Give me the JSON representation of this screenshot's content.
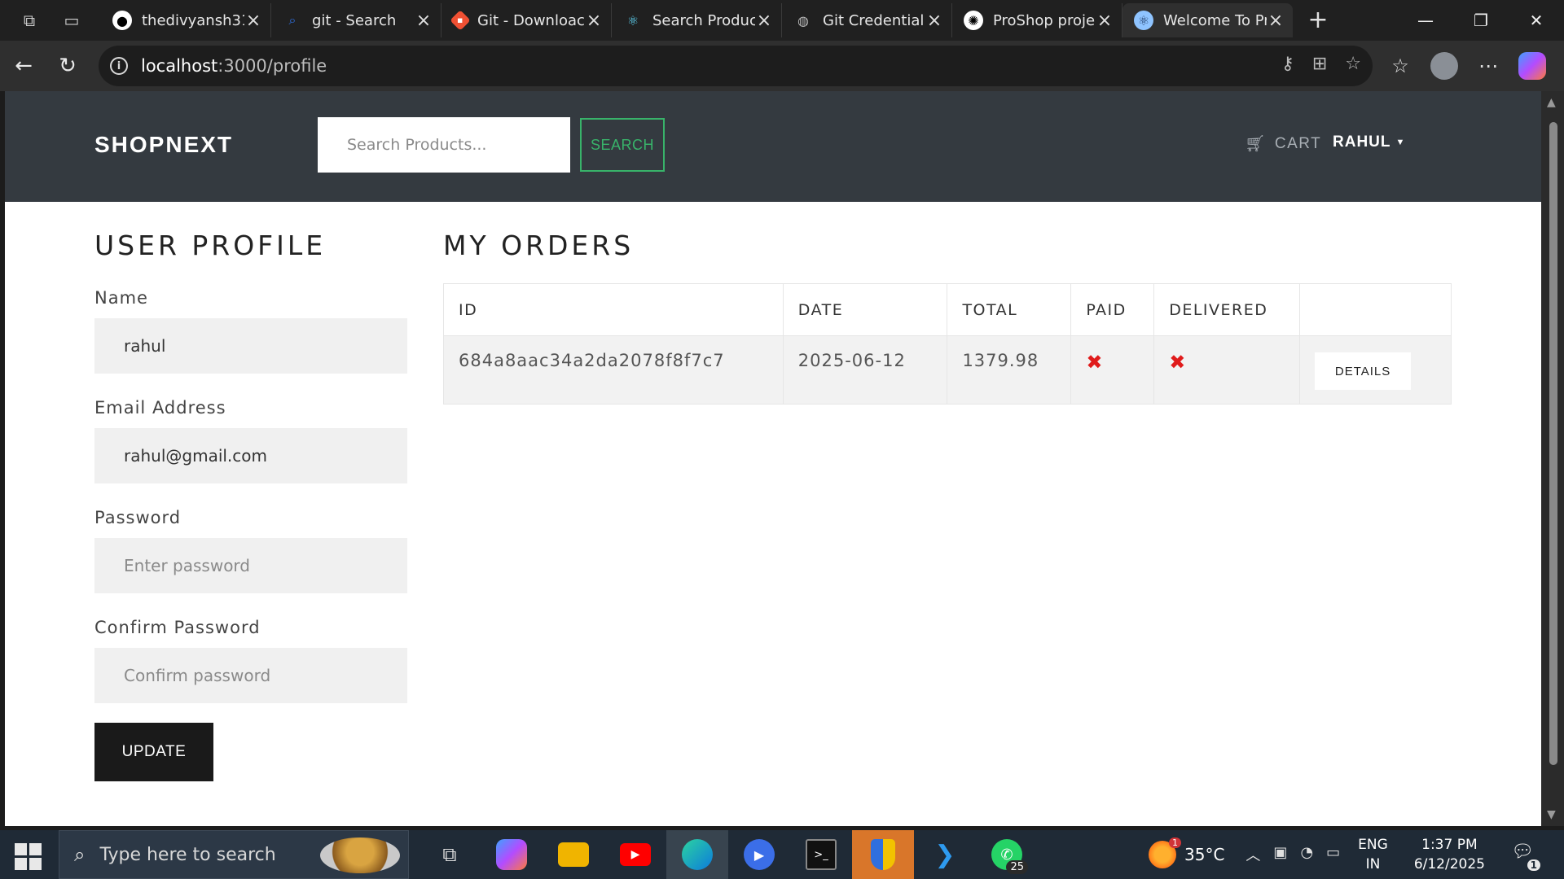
{
  "browser": {
    "tabs": [
      {
        "title": "thedivyansh31",
        "icon": "github-icon",
        "color": "#ffffff"
      },
      {
        "title": "git - Search",
        "icon": "search-icon",
        "color": "#2f6fde"
      },
      {
        "title": "Git - Downloac",
        "icon": "git-icon",
        "color": "#f05033"
      },
      {
        "title": "Search Produc",
        "icon": "react-icon",
        "color": "#61dafb"
      },
      {
        "title": "Git Credential",
        "icon": "globe-icon",
        "color": "#bbbbbb"
      },
      {
        "title": "ProShop proje",
        "icon": "chatgpt-icon",
        "color": "#ffffff"
      },
      {
        "title": "Welcome To Pr",
        "icon": "react-icon",
        "color": "#8fc4ff",
        "active": true
      }
    ],
    "url": {
      "host": "localhost",
      "path": ":3000/profile"
    }
  },
  "header": {
    "brand": "SHOPNEXT",
    "search_placeholder": "Search Products...",
    "search_button": "SEARCH",
    "cart_label": "CART",
    "user_label": "RAHUL"
  },
  "profile": {
    "title": "USER PROFILE",
    "name_label": "Name",
    "name_value": "rahul",
    "email_label": "Email Address",
    "email_value": "rahul@gmail.com",
    "password_label": "Password",
    "password_placeholder": "Enter password",
    "confirm_label": "Confirm Password",
    "confirm_placeholder": "Confirm password",
    "update_button": "UPDATE"
  },
  "orders": {
    "title": "MY ORDERS",
    "columns": [
      "ID",
      "DATE",
      "TOTAL",
      "PAID",
      "DELIVERED",
      ""
    ],
    "rows": [
      {
        "id": "684a8aac34a2da2078f8f7c7",
        "date": "2025-06-12",
        "total": "1379.98",
        "paid": "✖",
        "delivered": "✖",
        "action": "DETAILS"
      }
    ]
  },
  "taskbar": {
    "search_placeholder": "Type here to search",
    "whatsapp_badge": "25",
    "weather": "35°C",
    "weather_badge": "1",
    "lang_top": "ENG",
    "lang_bottom": "IN",
    "time": "1:37 PM",
    "date": "6/12/2025",
    "notifications": "1"
  },
  "colors": {
    "header_bg": "#343a40",
    "accent_green": "#38b36a",
    "error_red": "#e01b1b"
  }
}
